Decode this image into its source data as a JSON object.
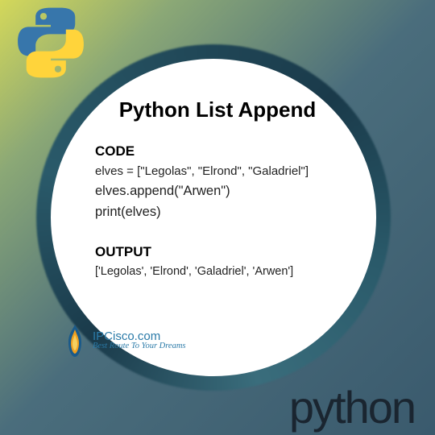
{
  "title": "Python List Append",
  "code_label": "CODE",
  "code": {
    "line1": "elves = [\"Legolas\", \"Elrond\", \"Galadriel\"]",
    "line2": "elves.append(\"Arwen\")",
    "line3": "print(elves)"
  },
  "output_label": "OUTPUT",
  "output": {
    "line1": "['Legolas', 'Elrond', 'Galadriel', 'Arwen']"
  },
  "branding": {
    "site_name": "IPCisco.com",
    "tagline": "Best Route To Your Dreams"
  },
  "footer_text": "python"
}
